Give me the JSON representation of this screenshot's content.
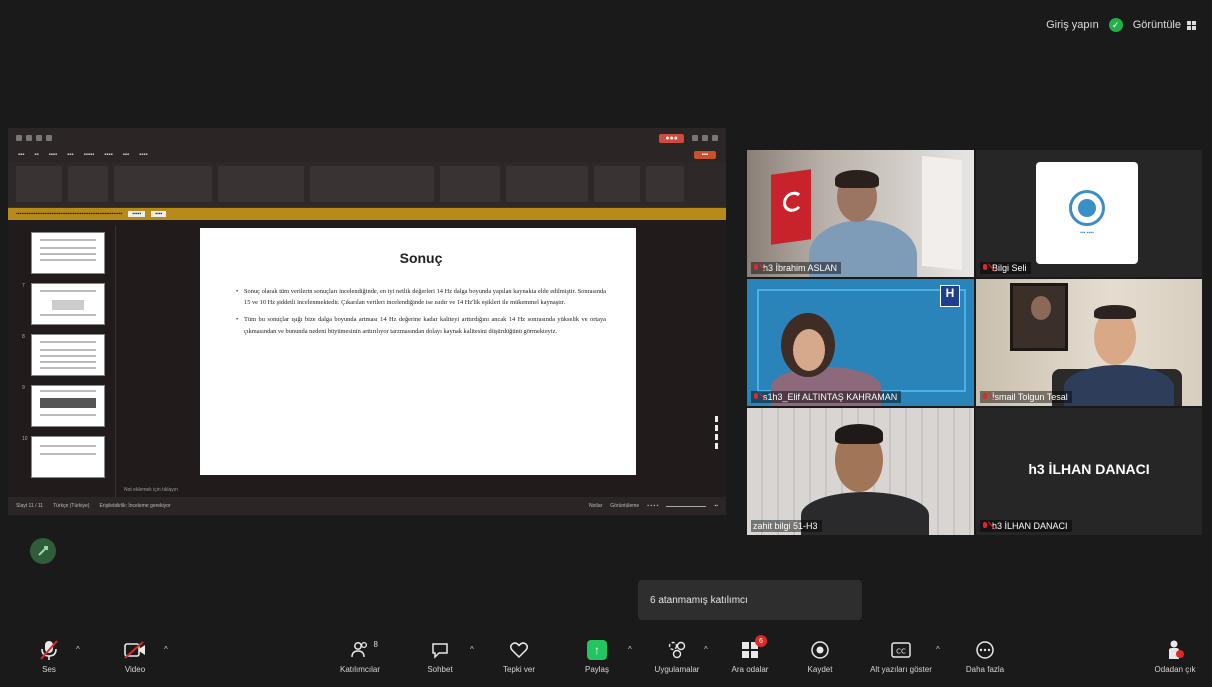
{
  "top_status": {
    "login": "Giriş yapın",
    "view": "Görüntüle"
  },
  "shared_screen": {
    "slide": {
      "title": "Sonuç",
      "bullets": [
        "Sonuç olarak tüm verilerin sonuçları incelendiğinde, en iyi netlik değerleri 14 Hz dalga boyunda yapılan kaynakta elde edilmiştir. Sonrasında 15 ve 10 Hz şiddetli incelenmektedir. Çıkarılan verileri incelendiğinde ise ısıdır ve 14 Hz'lik eşikleri ile mükemmel kaynaştır.",
        "Tüm bu sonuçlar ışığı bize dalga boyunda artması 14 Hz değerine kadar kaliteyi arttırdığını ancak 14 Hz sonrasında yükselik ve ortaya çıkmasından ve bununda nedeni büyümesinin arttırılıyor tarzmasından dolayı kaynak kalitesini düşürdüğünü görmekteyiz."
      ]
    },
    "thumb_numbers": [
      "",
      "7",
      "8",
      "9",
      "10"
    ],
    "notes_hint": "Not eklemek için tıklayın",
    "status_left": [
      "Slayt 11 / 11",
      "Türkçe (Türkiye)",
      "Erişilebilirlik: İnceleme gerekiyor"
    ],
    "status_right": [
      "Notlar",
      "Görüntüleme"
    ]
  },
  "participants": [
    {
      "name": "h3 İbrahim ASLAN",
      "muted": true
    },
    {
      "name": "Bilgi Seli",
      "muted": true
    },
    {
      "name": "s1h3_Elif ALTINTAŞ KAHRAMAN",
      "muted": true
    },
    {
      "name": "İsmail Tolgun Tesal",
      "muted": true
    },
    {
      "name": "zahit bilgi 51-H3",
      "muted": false
    },
    {
      "name": "h3 İLHAN DANACI",
      "muted": true,
      "display_name": "h3 İLHAN DANACI"
    }
  ],
  "toast": "6 atanmamış katılımcı",
  "toolbar": {
    "mute": "Ses",
    "video": "Video",
    "participants": "Katılımcılar",
    "participants_count": "8",
    "chat": "Sohbet",
    "react": "Tepki ver",
    "share": "Paylaş",
    "apps": "Uygulamalar",
    "breakout": "Ara odalar",
    "breakout_badge": "6",
    "record": "Kaydet",
    "captions": "Alt yazıları göster",
    "more": "Daha fazla",
    "leave": "Odadan çık"
  },
  "colors": {
    "active_speaker": "#23d18b",
    "share_green": "#22c55e",
    "mute_red": "#e02828"
  }
}
